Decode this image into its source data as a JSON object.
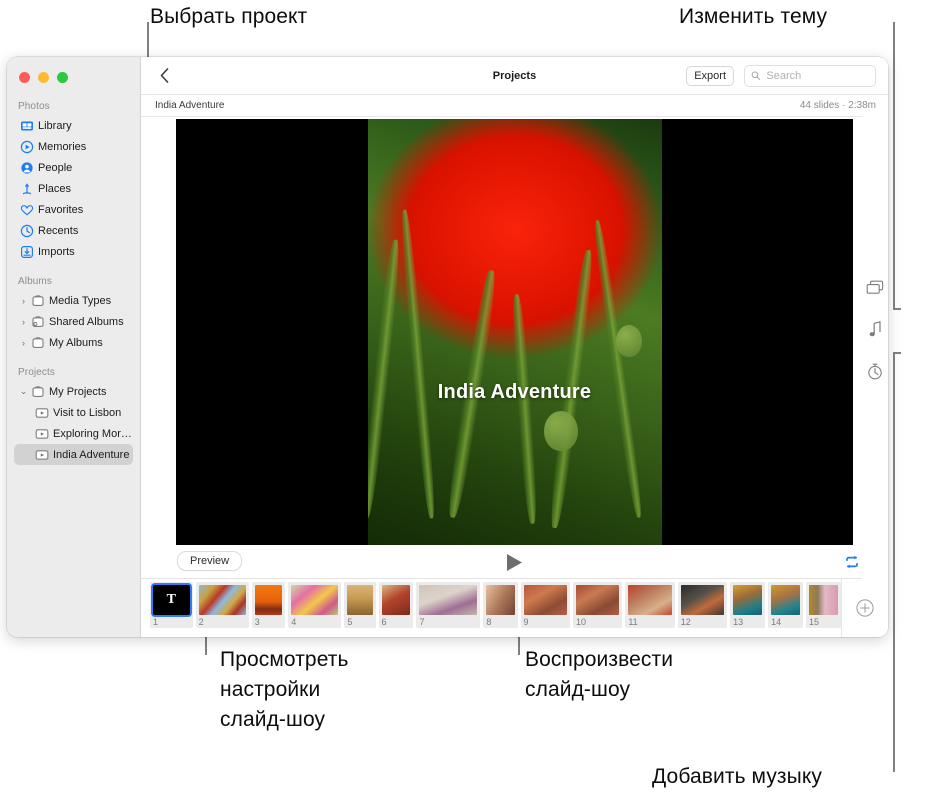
{
  "callouts": [
    {
      "id": "select-project",
      "text": "Выбрать проект"
    },
    {
      "id": "change-theme",
      "text": "Изменить тему"
    },
    {
      "id": "preview-settings",
      "text": "Просмотреть\nнастройки\nслайд-шоу"
    },
    {
      "id": "play-slideshow",
      "text": "Воспроизвести\nслайд-шоу"
    },
    {
      "id": "add-music",
      "text": "Добавить музыку"
    }
  ],
  "window": {
    "traffic_lights": [
      "close",
      "minimize",
      "zoom"
    ]
  },
  "sidebar": {
    "sections": [
      {
        "header": "Photos",
        "items": [
          {
            "label": "Library",
            "icon": "library-icon",
            "selected": false,
            "twisty": null,
            "child": false
          },
          {
            "label": "Memories",
            "icon": "memories-icon",
            "selected": false,
            "twisty": null,
            "child": false
          },
          {
            "label": "People",
            "icon": "people-icon",
            "selected": false,
            "twisty": null,
            "child": false
          },
          {
            "label": "Places",
            "icon": "places-icon",
            "selected": false,
            "twisty": null,
            "child": false
          },
          {
            "label": "Favorites",
            "icon": "favorites-icon",
            "selected": false,
            "twisty": null,
            "child": false
          },
          {
            "label": "Recents",
            "icon": "recents-icon",
            "selected": false,
            "twisty": null,
            "child": false
          },
          {
            "label": "Imports",
            "icon": "imports-icon",
            "selected": false,
            "twisty": null,
            "child": false
          }
        ]
      },
      {
        "header": "Albums",
        "items": [
          {
            "label": "Media Types",
            "icon": "album-icon",
            "selected": false,
            "twisty": "collapsed",
            "child": false
          },
          {
            "label": "Shared Albums",
            "icon": "shared-album-icon",
            "selected": false,
            "twisty": "collapsed",
            "child": false
          },
          {
            "label": "My Albums",
            "icon": "album-icon",
            "selected": false,
            "twisty": "collapsed",
            "child": false
          }
        ]
      },
      {
        "header": "Projects",
        "items": [
          {
            "label": "My Projects",
            "icon": "album-icon",
            "selected": false,
            "twisty": "expanded",
            "child": false
          },
          {
            "label": "Visit to Lisbon",
            "icon": "slideshow-icon",
            "selected": false,
            "twisty": null,
            "child": true
          },
          {
            "label": "Exploring Mor…",
            "icon": "slideshow-icon",
            "selected": false,
            "twisty": null,
            "child": true
          },
          {
            "label": "India Adventure",
            "icon": "slideshow-icon",
            "selected": true,
            "twisty": null,
            "child": true
          }
        ]
      }
    ]
  },
  "toolbar": {
    "back_icon": "chevron-left-icon",
    "title": "Projects",
    "export_label": "Export",
    "search_placeholder": "Search",
    "search_value": "",
    "search_icon": "search-icon"
  },
  "subbar": {
    "project_name": "India Adventure",
    "meta": "44 slides · 2:38m"
  },
  "stage": {
    "slide_caption": "India Adventure",
    "preview_label": "Preview",
    "play_icon": "play-icon",
    "loop_icon": "loop-icon",
    "loop_color": "#1f7bf4"
  },
  "filmstrip": {
    "add_icon": "plus-circle-icon",
    "thumbs": [
      {
        "num": "1",
        "width": "48",
        "selected": true,
        "title_card": true,
        "letter": "T",
        "bg": "#000000"
      },
      {
        "num": "2",
        "width": "62",
        "selected": false,
        "title_card": false,
        "bg": "linear-gradient(130deg,#8fb8dd 0%,#c9a13c 22%,#b63a2c 38%,#8fb8dd 52%,#d1a845 68%,#a8352a 82%,#8fb8dd 100%)"
      },
      {
        "num": "3",
        "width": "36",
        "selected": false,
        "title_card": false,
        "bg": "linear-gradient(180deg,#f07a12 0%,#e85f0a 55%,#7d2f14 80%,#b33a1a 100%)"
      },
      {
        "num": "4",
        "width": "62",
        "selected": false,
        "title_card": false,
        "bg": "linear-gradient(140deg,#cfd8a0 0%,#e46fa6 30%,#f1c94b 55%,#cf5a8c 78%,#b7c97a 100%)"
      },
      {
        "num": "5",
        "width": "33",
        "selected": false,
        "title_card": false,
        "bg": "linear-gradient(180deg,#d9b477 0%,#c79a52 45%,#8a6433 100%)"
      },
      {
        "num": "6",
        "width": "38",
        "selected": false,
        "title_card": false,
        "bg": "linear-gradient(150deg,#d8b783 0%,#b3432c 45%,#7c2a1c 100%)"
      },
      {
        "num": "7",
        "width": "76",
        "selected": false,
        "title_card": false,
        "bg": "linear-gradient(160deg,#cfc4bc 0%,#ddd3cb 40%,#9e6f93 70%,#c3b6ae 100%)"
      },
      {
        "num": "8",
        "width": "37",
        "selected": false,
        "title_card": false,
        "bg": "linear-gradient(120deg,#e8c1a3 0%,#b07a5c 50%,#6d4334 100%)"
      },
      {
        "num": "9",
        "width": "57",
        "selected": false,
        "title_card": false,
        "bg": "linear-gradient(150deg,#b8553c 0%,#cf7a4d 35%,#8c4c33 70%,#b5624a 100%)"
      },
      {
        "num": "10",
        "width": "57",
        "selected": false,
        "title_card": false,
        "bg": "linear-gradient(150deg,#a84a33 0%,#c97a52 35%,#8a4a32 70%,#b06047 100%)"
      },
      {
        "num": "11",
        "width": "57",
        "selected": false,
        "title_card": false,
        "bg": "linear-gradient(150deg,#c1402b 0%,#b9795a 35%,#d8b08c 70%,#c0452f 100%)"
      },
      {
        "num": "12",
        "width": "57",
        "selected": false,
        "title_card": false,
        "bg": "linear-gradient(150deg,#2e2b28 0%,#55514a 40%,#c26a3a 65%,#3a3733 100%)"
      },
      {
        "num": "13",
        "width": "38",
        "selected": false,
        "title_card": false,
        "bg": "linear-gradient(160deg,#d79f2e 0%,#9a6b3a 40%,#1d7f8a 75%,#155f6a 100%)"
      },
      {
        "num": "14",
        "width": "38",
        "selected": false,
        "title_card": false,
        "bg": "linear-gradient(160deg,#cf9a2c 0%,#a87244 40%,#1f8490 75%,#15626c 100%)"
      },
      {
        "num": "15",
        "width": "38",
        "selected": false,
        "title_card": false,
        "bg": "linear-gradient(90deg,#b08a2a 0%,#8d7a5a 30%,#e4b9c6 55%,#d89bb0 100%)"
      }
    ]
  },
  "rail": {
    "buttons": [
      {
        "icon": "theme-icon",
        "name": "theme-button"
      },
      {
        "icon": "music-note-icon",
        "name": "music-button"
      },
      {
        "icon": "duration-timer-icon",
        "name": "duration-button"
      }
    ]
  }
}
